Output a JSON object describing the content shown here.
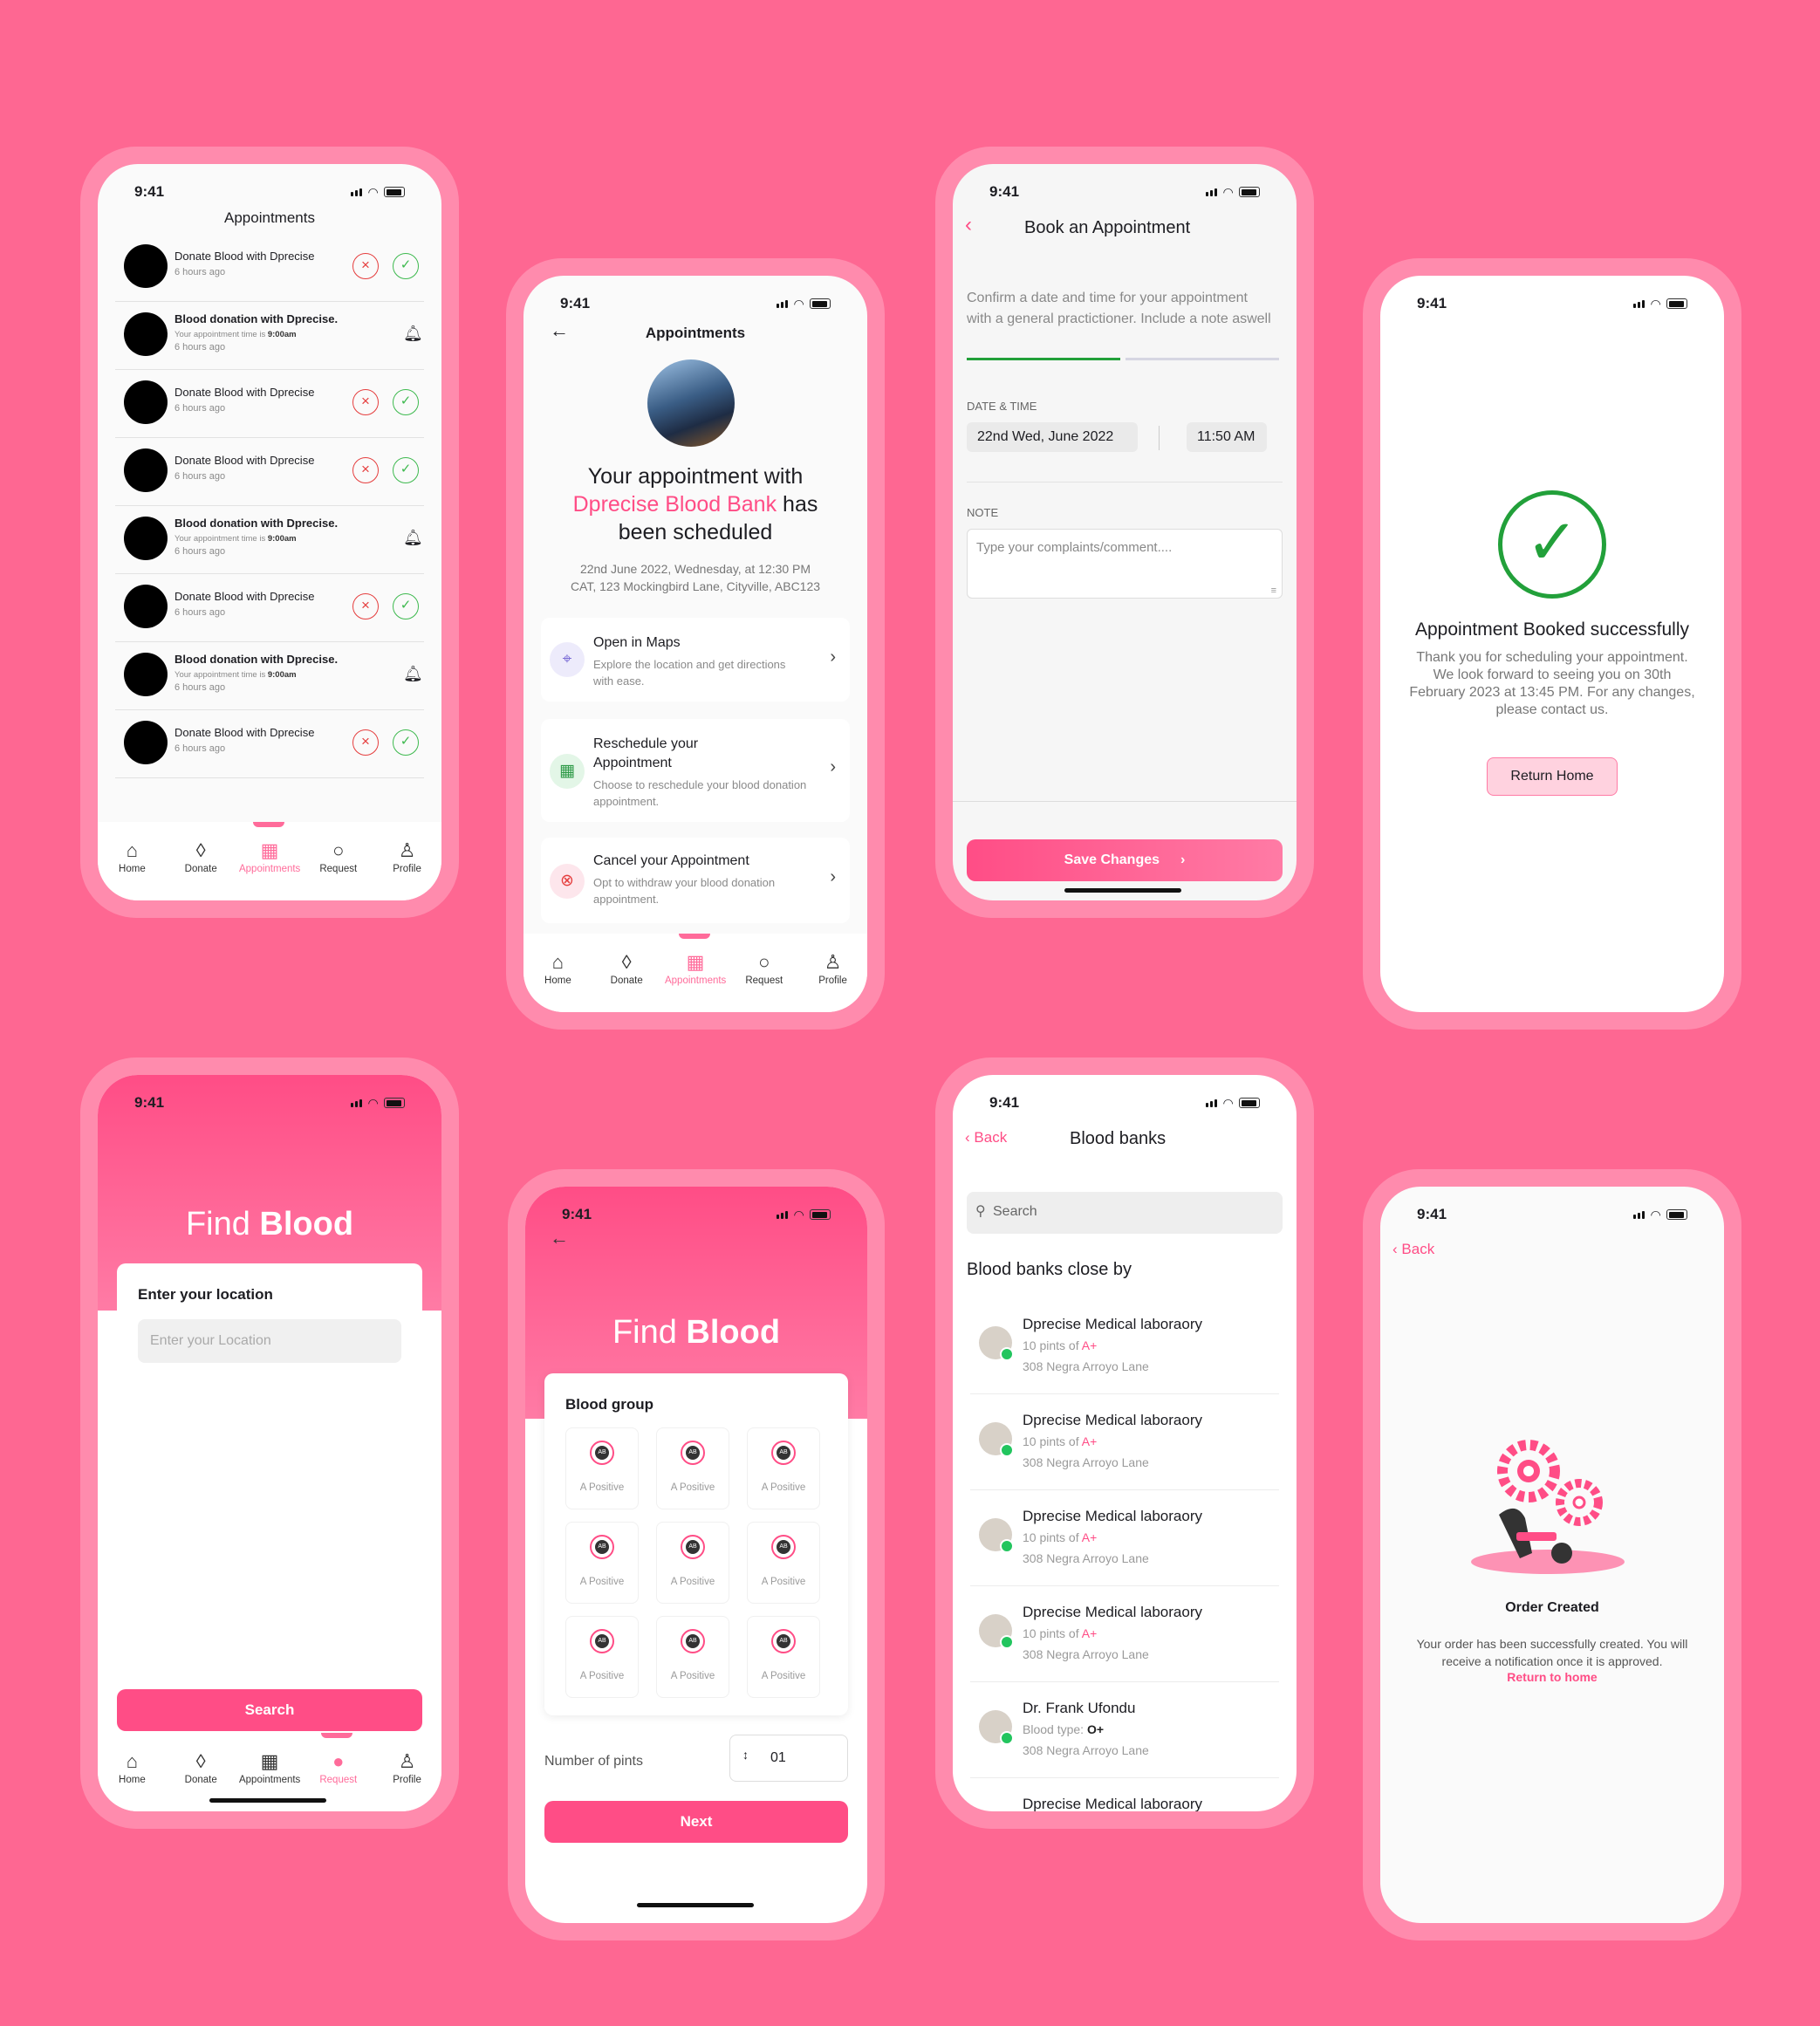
{
  "status_time": "9:41",
  "nav": {
    "home": "Home",
    "donate": "Donate",
    "appointments": "Appointments",
    "request": "Request",
    "profile": "Profile"
  },
  "appointments_list": {
    "title": "Appointments",
    "donate_title": "Donate Blood with Dprecise",
    "reminder_title": "Blood donation with Dprecise.",
    "reminder_note": "Your appointment time is",
    "reminder_time": "9:00am",
    "ago": "6 hours ago"
  },
  "appointment_detail": {
    "title": "Appointments",
    "heading_1": "Your appointment with",
    "heading_brand": "Dprecise Blood Bank",
    "heading_2": "has",
    "heading_3": "been scheduled",
    "details_line1": "22nd June 2022, Wednesday, at 12:30 PM",
    "details_line2": "CAT, 123 Mockingbird Lane, Cityville, ABC123",
    "maps_title": "Open in Maps",
    "maps_sub": "Explore the location and get directions with ease.",
    "reschedule_title": "Reschedule your Appointment",
    "reschedule_sub": "Choose to reschedule your blood donation appointment.",
    "cancel_title": "Cancel your Appointment",
    "cancel_sub": "Opt to withdraw your blood donation appointment."
  },
  "book": {
    "title": "Book an Appointment",
    "intro": "Confirm a date and time for your appointment with a general practictioner. Include a note aswell",
    "date_label": "DATE & TIME",
    "date": "22nd Wed, June 2022",
    "time": "11:50 AM",
    "note_label": "NOTE",
    "note_placeholder": "Type your complaints/comment....",
    "save": "Save Changes"
  },
  "success": {
    "title": "Appointment Booked successfully",
    "body": "Thank you for scheduling your appointment. We look forward to seeing you on 30th February 2023 at 13:45 PM. For any changes, please contact us.",
    "button": "Return Home"
  },
  "find_location": {
    "title_light": "Find",
    "title_bold": "Blood",
    "label": "Enter your location",
    "placeholder": "Enter your Location",
    "search": "Search"
  },
  "find_group": {
    "title_light": "Find",
    "title_bold": "Blood",
    "group_label": "Blood group",
    "group_item": "A Positive",
    "pints_label": "Number of pints",
    "pints_value": "01",
    "next": "Next"
  },
  "banks": {
    "back": "Back",
    "title": "Blood banks",
    "search_placeholder": "Search",
    "section": "Blood banks close by",
    "items": [
      {
        "name": "Dprecise Medical laboraory",
        "pre": "10 pints of",
        "type": "A+",
        "addr": "308 Negra Arroyo Lane"
      },
      {
        "name": "Dprecise Medical laboraory",
        "pre": "10 pints of",
        "type": "A+",
        "addr": "308 Negra Arroyo Lane"
      },
      {
        "name": "Dprecise Medical laboraory",
        "pre": "10 pints of",
        "type": "A+",
        "addr": "308 Negra Arroyo Lane"
      },
      {
        "name": "Dprecise Medical laboraory",
        "pre": "10 pints of",
        "type": "A+",
        "addr": "308 Negra Arroyo Lane"
      },
      {
        "name": "Dr. Frank Ufondu",
        "pre": "Blood type:",
        "type": "O+",
        "addr": "308 Negra Arroyo Lane"
      }
    ],
    "partial": "Dprecise Medical laboraory"
  },
  "order": {
    "back": "Back",
    "title": "Order Created",
    "body": "Your order has been successfully created. You will receive a notification once it is approved.",
    "link": "Return to home"
  },
  "colors": {
    "background": "#FE6792",
    "phone_frame": "#FF8BAD",
    "accent": "#FF4D86",
    "success": "#22A03A",
    "danger": "#E53E3E"
  }
}
